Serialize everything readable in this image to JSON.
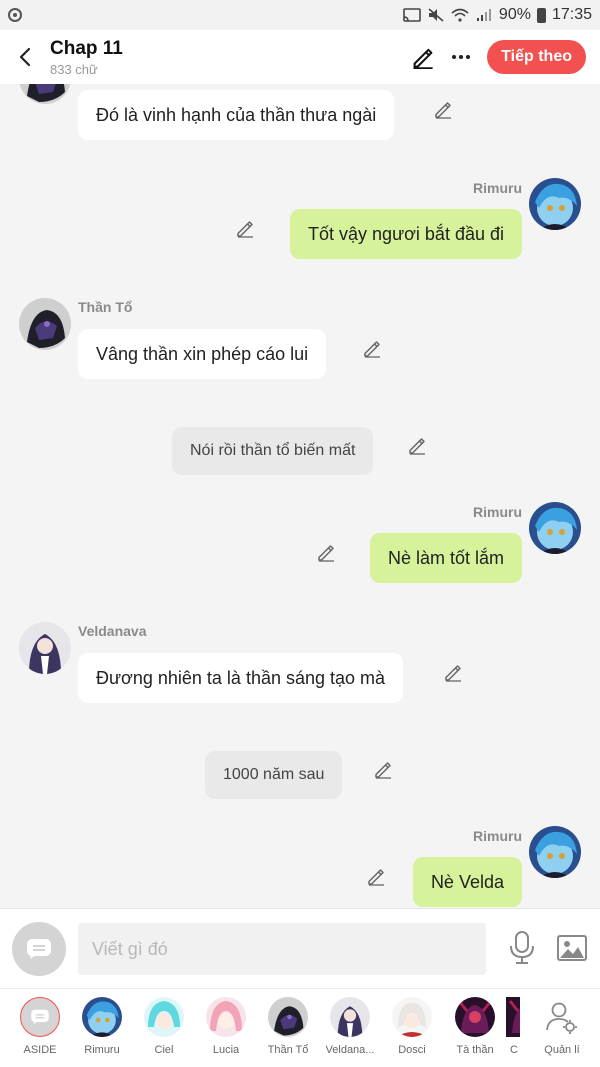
{
  "status_bar": {
    "battery": "90%",
    "time": "17:35"
  },
  "header": {
    "title": "Chap 11",
    "subtitle": "833 chữ",
    "next_label": "Tiếp theo"
  },
  "messages": [
    {
      "type": "left",
      "speaker": "Thần Tổ",
      "text": "Đó là vinh hạnh của thần thưa ngài"
    },
    {
      "type": "right",
      "speaker": "Rimuru",
      "text": "Tốt vậy ngươi bắt đầu đi"
    },
    {
      "type": "left",
      "speaker": "Thần Tổ",
      "text": "Vâng thần xin phép cáo lui"
    },
    {
      "type": "narration",
      "text": "Nói rồi thần tổ biến mất"
    },
    {
      "type": "right",
      "speaker": "Rimuru",
      "text": "Nè làm tốt lắm"
    },
    {
      "type": "left",
      "speaker": "Veldanava",
      "text": "Đương nhiên ta là thần sáng tạo mà"
    },
    {
      "type": "narration",
      "text": "1000 năm sau"
    },
    {
      "type": "right",
      "speaker": "Rimuru",
      "text": "Nè Velda"
    }
  ],
  "input": {
    "placeholder": "Viết gì đó"
  },
  "characters": [
    {
      "label": "ASIDE"
    },
    {
      "label": "Rimuru"
    },
    {
      "label": "Ciel"
    },
    {
      "label": "Lucia"
    },
    {
      "label": "Thần Tổ"
    },
    {
      "label": "Veldana..."
    },
    {
      "label": "Dosci"
    },
    {
      "label": "Tà thần"
    },
    {
      "label": "C"
    },
    {
      "label": "Quản lí"
    }
  ],
  "colors": {
    "accent": "#f35050",
    "right_bubble": "#d6f29a",
    "left_bubble": "#ffffff",
    "narration_bubble": "#e9e9e9"
  }
}
